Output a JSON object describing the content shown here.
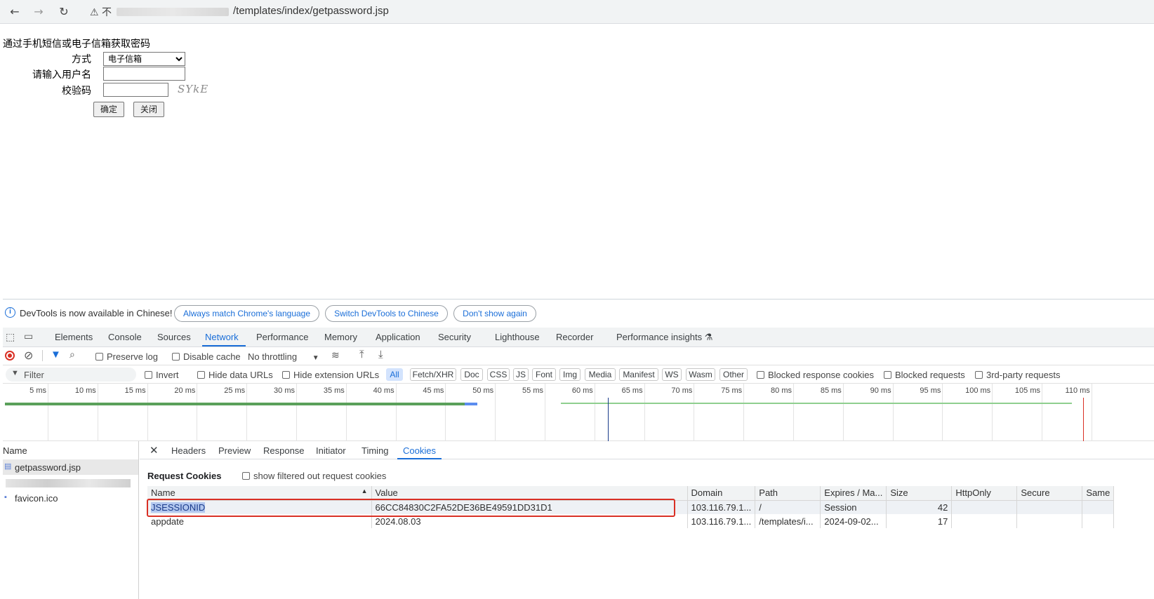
{
  "browser": {
    "url_path": "/templates/index/getpassword.jsp",
    "warning_text": "不"
  },
  "page": {
    "heading": "通过手机短信或电子信箱获取密码",
    "method_label": "方式",
    "method_value": "电子信箱",
    "username_label": "请输入用户名",
    "captcha_label": "校验码",
    "captcha_text": "SYkE",
    "ok_button": "确定",
    "close_button": "关闭"
  },
  "devtools": {
    "info_text": "DevTools is now available in Chinese!",
    "info_buttons": [
      "Always match Chrome's language",
      "Switch DevTools to Chinese",
      "Don't show again"
    ],
    "tabs": [
      "Elements",
      "Console",
      "Sources",
      "Network",
      "Performance",
      "Memory",
      "Application",
      "Security",
      "Lighthouse",
      "Recorder",
      "Performance insights"
    ],
    "active_tab": "Network",
    "netbar": {
      "preserve_log": "Preserve log",
      "disable_cache": "Disable cache",
      "throttling": "No throttling"
    },
    "filterbar": {
      "filter_placeholder": "Filter",
      "invert": "Invert",
      "hide_data_urls": "Hide data URLs",
      "hide_extension_urls": "Hide extension URLs",
      "chips": [
        "All",
        "Fetch/XHR",
        "Doc",
        "CSS",
        "JS",
        "Font",
        "Img",
        "Media",
        "Manifest",
        "WS",
        "Wasm",
        "Other"
      ],
      "blocked_response_cookies": "Blocked response cookies",
      "blocked_requests": "Blocked requests",
      "third_party": "3rd-party requests"
    },
    "timeline_ticks": [
      "5 ms",
      "10 ms",
      "15 ms",
      "20 ms",
      "25 ms",
      "30 ms",
      "35 ms",
      "40 ms",
      "45 ms",
      "50 ms",
      "55 ms",
      "60 ms",
      "65 ms",
      "70 ms",
      "75 ms",
      "80 ms",
      "85 ms",
      "90 ms",
      "95 ms",
      "100 ms",
      "105 ms",
      "110 ms"
    ],
    "requests": {
      "header": "Name",
      "items": [
        "getpassword.jsp",
        "favicon.ico"
      ]
    },
    "subtabs": [
      "Headers",
      "Preview",
      "Response",
      "Initiator",
      "Timing",
      "Cookies"
    ],
    "active_subtab": "Cookies",
    "cookies": {
      "section_title": "Request Cookies",
      "show_filtered": "show filtered out request cookies",
      "columns": [
        "Name",
        "Value",
        "Domain",
        "Path",
        "Expires / Ma...",
        "Size",
        "HttpOnly",
        "Secure",
        "Same"
      ],
      "rows": [
        [
          "JSESSIONID",
          "66CC84830C2FA52DE36BE49591DD31D1",
          "103.116.79.1...",
          "/",
          "Session",
          "42",
          "",
          "",
          ""
        ],
        [
          "appdate",
          "2024.08.03",
          "103.116.79.1...",
          "/templates/i...",
          "2024-09-02...",
          "17",
          "",
          "",
          ""
        ]
      ]
    },
    "colors": {
      "accent": "#1a6ed8",
      "highlight_box": "#d93025"
    }
  }
}
